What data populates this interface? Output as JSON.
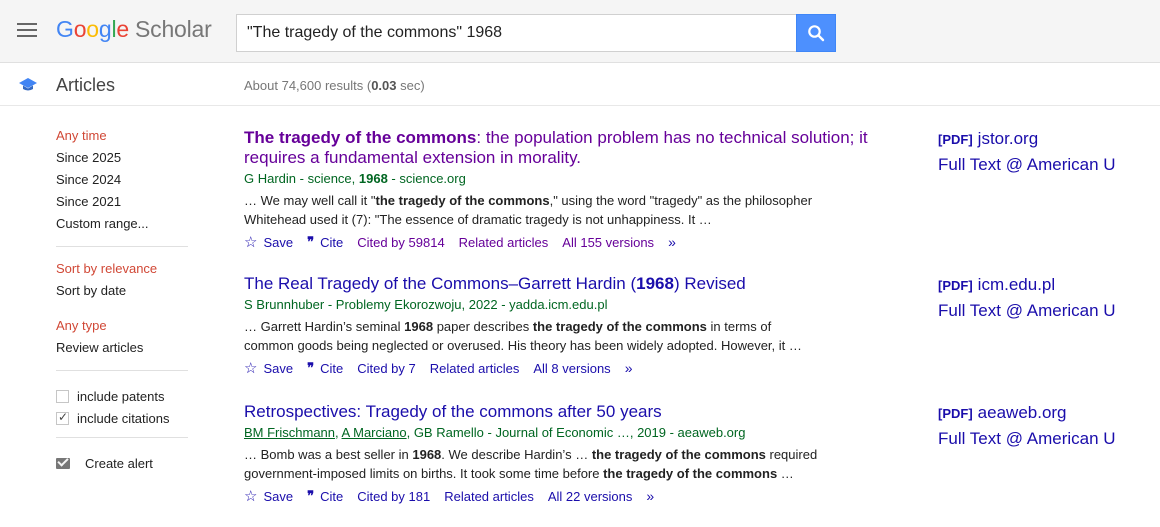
{
  "header": {
    "logo_google": [
      "G",
      "o",
      "o",
      "g",
      "l",
      "e"
    ],
    "logo_scholar": "Scholar",
    "search_value": "\"The tragedy of the commons\" 1968"
  },
  "subheader": {
    "section": "Articles",
    "results_prefix": "About 74,600 results (",
    "results_time": "0.03",
    "results_suffix": " sec)"
  },
  "sidebar": {
    "time": [
      "Any time",
      "Since 2025",
      "Since 2024",
      "Since 2021",
      "Custom range..."
    ],
    "sort": [
      "Sort by relevance",
      "Sort by date"
    ],
    "type": [
      "Any type",
      "Review articles"
    ],
    "include_patents": "include patents",
    "include_citations": "include citations",
    "create_alert": "Create alert"
  },
  "results": [
    {
      "title_bold": "The tragedy of the commons",
      "title_rest": ": the population problem has no technical solution; it requires a fundamental extension in morality.",
      "meta_pre": "G Hardin - science, ",
      "meta_bold": "1968",
      "meta_post": " - science.org",
      "snippet": [
        "… We may well call it \"",
        "the tragedy of the commons",
        ",\" using the word \"tragedy\" as the philosopher Whitehead used it (7): \"The essence of dramatic tragedy is not unhappiness. It …"
      ],
      "save": "Save",
      "cite": "Cite",
      "cited_by": "Cited by 59814",
      "related": "Related articles",
      "versions": "All 155 versions",
      "pdf_tag": "[PDF]",
      "pdf_host": "jstor.org",
      "fulltext": "Full Text @ American U"
    },
    {
      "title_pre": "The Real Tragedy of the Commons–Garrett Hardin (",
      "title_bold": "1968",
      "title_post": ") Revised",
      "meta": "S Brunnhuber - Problemy Ekorozwoju, 2022 - yadda.icm.edu.pl",
      "snippet": [
        "… Garrett Hardin’s seminal ",
        "1968",
        " paper describes ",
        "the tragedy of the commons",
        " in terms of common goods being neglected or overused. His theory has been widely adopted. However, it …"
      ],
      "save": "Save",
      "cite": "Cite",
      "cited_by": "Cited by 7",
      "related": "Related articles",
      "versions": "All 8 versions",
      "pdf_tag": "[PDF]",
      "pdf_host": "icm.edu.pl",
      "fulltext": "Full Text @ American U"
    },
    {
      "title": "Retrospectives: Tragedy of the commons after 50 years",
      "author1": "BM Frischmann",
      "author2": "A Marciano",
      "meta_post": ", GB Ramello - Journal of Economic …, 2019 - aeaweb.org",
      "snippet": [
        "… Bomb was a best seller in ",
        "1968",
        ". We describe Hardin’s … ",
        "the tragedy of the commons",
        " required government-imposed limits on births. It took some time before ",
        "the tragedy of the commons",
        " …"
      ],
      "save": "Save",
      "cite": "Cite",
      "cited_by": "Cited by 181",
      "related": "Related articles",
      "versions": "All 22 versions",
      "pdf_tag": "[PDF]",
      "pdf_host": "aeaweb.org",
      "fulltext": "Full Text @ American U"
    }
  ],
  "colors": {
    "link": "#1a0dab",
    "visited": "#660099",
    "meta_green": "#006621",
    "active_red": "#d14836",
    "search_blue": "#4d90fe"
  }
}
